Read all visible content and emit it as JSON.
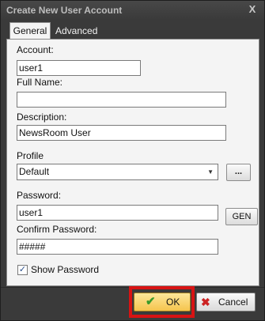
{
  "window": {
    "title": "Create New User Account",
    "close_label": "X"
  },
  "tabs": {
    "general": "General",
    "advanced": "Advanced"
  },
  "form": {
    "account_label": "Account:",
    "account_value": "user1",
    "fullname_label": "Full Name:",
    "fullname_value": "",
    "description_label": "Description:",
    "description_value": "NewsRoom User",
    "profile_label": "Profile",
    "profile_selected": "Default",
    "browse_label": "...",
    "password_label": "Password:",
    "password_value": "user1",
    "gen_label": "GEN",
    "confirm_label": "Confirm Password:",
    "confirm_value": "#####",
    "show_password_label": "Show Password",
    "show_password_checked": true
  },
  "buttons": {
    "ok_label": "OK",
    "cancel_label": "Cancel"
  },
  "colors": {
    "highlight": "#d81313",
    "ok_fill": "#f5c44d"
  },
  "icons": {
    "ok": "checkmark-icon",
    "cancel": "x-icon",
    "dropdown": "chevron-down-icon"
  }
}
